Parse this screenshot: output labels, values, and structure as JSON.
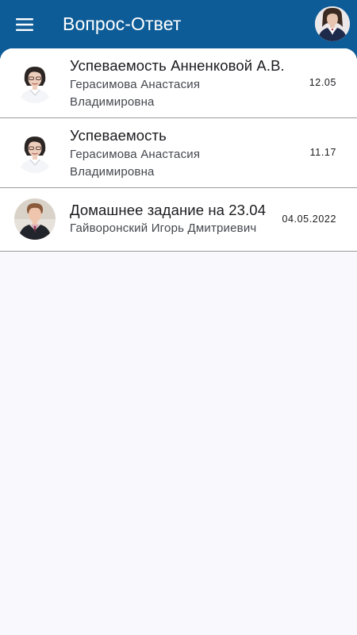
{
  "app_bar": {
    "title": "Вопрос-Ответ",
    "menu_icon": "hamburger-menu-icon",
    "profile_avatar": "user-avatar"
  },
  "messages": [
    {
      "title": "Успеваемость Анненковой А.В.",
      "author": "Герасимова Анастасия Владимировна",
      "date": "12.05",
      "avatar": "teacher-female-avatar"
    },
    {
      "title": "Успеваемость",
      "author": "Герасимова Анастасия Владимировна",
      "date": "11.17",
      "avatar": "teacher-female-avatar"
    },
    {
      "title": "Домашнее задание на 23.04",
      "author": "Гайворонский Игорь Дмитриевич",
      "date": "04.05.2022",
      "avatar": "teacher-male-avatar"
    }
  ],
  "colors": {
    "app_bar": "#0e5c97",
    "background": "#f9f9fd",
    "divider": "#9a9a9a"
  }
}
